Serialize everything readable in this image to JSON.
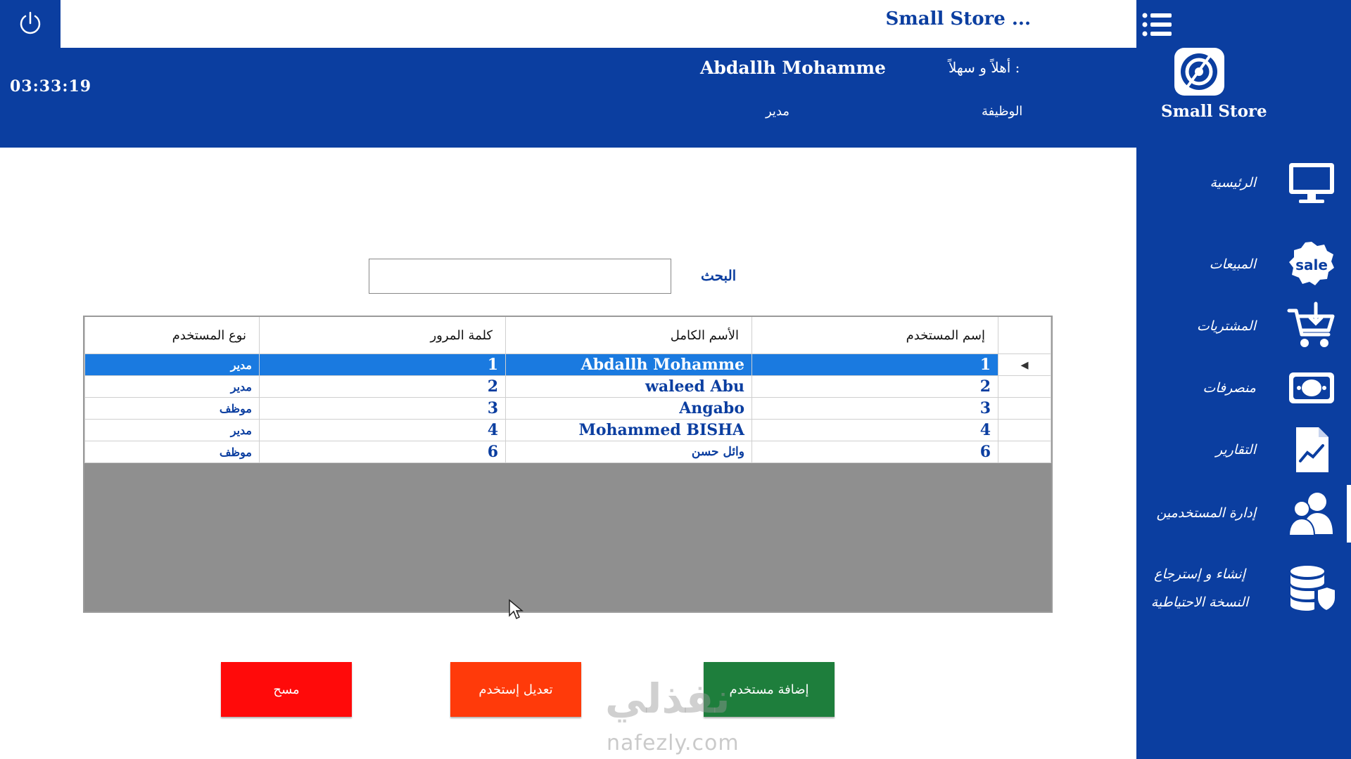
{
  "header": {
    "title": "Small Store ...",
    "clock": "03:33:19",
    "welcome_label": "أهلاً و سهلاً :",
    "user_name": "Abdallh Mohamme",
    "job_label": "الوظيفة",
    "job_value": "مدير"
  },
  "sidebar": {
    "logo_text": "Small Store",
    "items": [
      {
        "label": "الرئيسية",
        "icon": "monitor-icon"
      },
      {
        "label": "المبيعات",
        "icon": "sale-icon"
      },
      {
        "label": "المشتريات",
        "icon": "cart-icon"
      },
      {
        "label": "منصرفات",
        "icon": "money-icon"
      },
      {
        "label": "التقارير",
        "icon": "report-icon"
      },
      {
        "label": "إدارة المستخدمين",
        "icon": "users-icon"
      },
      {
        "label": "إنشاء و إسترجاع النسخة الاحتياطية",
        "icon": "database-icon"
      }
    ],
    "active_index": 5
  },
  "search": {
    "label": "البحث",
    "value": ""
  },
  "grid": {
    "columns": [
      "إسم المستخدم",
      "الأسم الكامل",
      "كلمة المرور",
      "نوع المستخدم"
    ],
    "rows": [
      {
        "username": "1",
        "full_name": "Abdallh Mohamme",
        "password": "1",
        "type": "مدير"
      },
      {
        "username": "2",
        "full_name": "waleed Abu",
        "password": "2",
        "type": "مدير"
      },
      {
        "username": "3",
        "full_name": "Angabo",
        "password": "3",
        "type": "موظف"
      },
      {
        "username": "4",
        "full_name": "Mohammed BISHA",
        "password": "4",
        "type": "مدير"
      },
      {
        "username": "6",
        "full_name": "وائل حسن",
        "password": "6",
        "type": "موظف"
      }
    ],
    "selected_row": 0
  },
  "buttons": {
    "delete": "مسح",
    "edit": "تعديل إستخدم",
    "add": "إضافة مستخدم"
  },
  "watermark": {
    "text": "نفذلي",
    "url": "nafezly.com"
  },
  "colors": {
    "primary": "#0b3ea0",
    "selected_row": "#1a7ae0",
    "delete": "#ff0a0a",
    "edit": "#ff3a0a",
    "add": "#1e7e3c"
  }
}
